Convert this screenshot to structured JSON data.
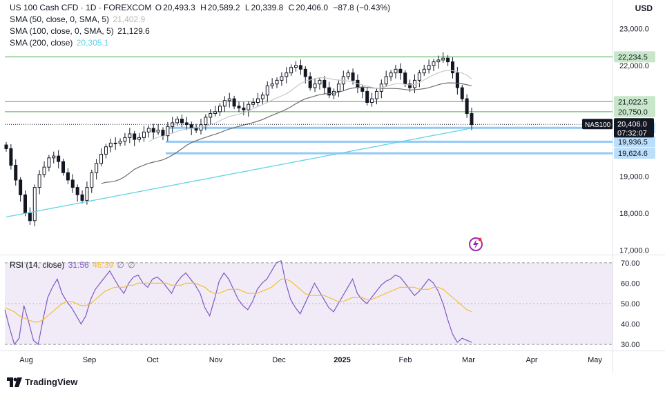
{
  "header": {
    "symbol_title": "US 100 Cash CFD · 1D · FOREXCOM",
    "ohlc": [
      {
        "label": "O",
        "value": "20,493.3"
      },
      {
        "label": "H",
        "value": "20,589.2"
      },
      {
        "label": "L",
        "value": "20,339.8"
      },
      {
        "label": "C",
        "value": "20,406.0"
      }
    ],
    "change": "−87.8 (−0.43%)",
    "currency": "USD"
  },
  "indicators": {
    "sma50": {
      "label": "SMA (50, close, 0, SMA, 5)",
      "value": "21,402.9",
      "color": "#b9b9b9"
    },
    "sma100": {
      "label": "SMA (100, close, 0, SMA, 5)",
      "value": "21,129.6",
      "color": "#555555"
    },
    "sma200": {
      "label": "SMA (200, close)",
      "value": "20,305.1",
      "color": "#62d3e6"
    }
  },
  "rsi_legend": {
    "label": "RSI (14, close)",
    "value": "31.56",
    "sma_value": "46.39",
    "zero1": "∅",
    "zero2": "∅"
  },
  "branding": {
    "name": "TradingView",
    "bolt_icon": "flash-icon"
  },
  "badges": {
    "symbol": "NAS100",
    "price": "20,406.0",
    "countdown": "07:32:07"
  },
  "chart_data": [
    {
      "type": "candlestick",
      "title": "US 100 Cash CFD · 1D · FOREXCOM",
      "y_axis": {
        "ticks": [
          17000,
          18000,
          19000,
          20000,
          21000,
          22000,
          23000
        ],
        "tick_labels": [
          "17,000.0",
          "18,000.0",
          "19,000.0",
          "20,000.0",
          "21,000.0",
          "22,000.0",
          "23,000.0"
        ],
        "range": [
          16900,
          23400
        ]
      },
      "x_axis": {
        "ticks": [
          "Aug",
          "Sep",
          "Oct",
          "Nov",
          "Dec",
          "2025",
          "Feb",
          "Mar",
          "Apr",
          "May"
        ]
      },
      "horizontal_levels": [
        {
          "value": 22234.5,
          "label": "22,234.5",
          "color": "#66bb6a"
        },
        {
          "value": 21022.5,
          "label": "21,022.5",
          "color": "#66bb6a"
        },
        {
          "value": 20750.0,
          "label": "20,750.0",
          "color": "#66bb6a"
        },
        {
          "value": 20314.5,
          "label": "20,314.5",
          "color": "#2196f3"
        },
        {
          "value": 19936.5,
          "label": "19,936.5",
          "color": "#2196f3"
        },
        {
          "value": 19624.6,
          "label": "19,624.6",
          "color": "#2196f3"
        }
      ],
      "series": [
        {
          "name": "US 100 Cash CFD",
          "kind": "ohlc",
          "close_path": [
            19750,
            19300,
            18900,
            18500,
            18000,
            17800,
            18700,
            19050,
            19250,
            19500,
            19550,
            19400,
            19100,
            18900,
            18700,
            18500,
            18350,
            18700,
            19100,
            19350,
            19600,
            19800,
            19900,
            19900,
            19950,
            20050,
            20150,
            20000,
            20050,
            20200,
            20300,
            20200,
            20250,
            20100,
            20350,
            20450,
            20550,
            20450,
            20400,
            20300,
            20250,
            20400,
            20600,
            20700,
            20750,
            20900,
            21050,
            21100,
            20900,
            20850,
            20800,
            20950,
            21000,
            21100,
            21200,
            21450,
            21500,
            21600,
            21700,
            21800,
            21950,
            22000,
            21900,
            21700,
            21400,
            21500,
            21600,
            21400,
            21200,
            21300,
            21500,
            21700,
            21800,
            21600,
            21400,
            21300,
            21000,
            21100,
            21300,
            21500,
            21700,
            21800,
            21900,
            21800,
            21500,
            21400,
            21600,
            21800,
            21900,
            22000,
            22100,
            22150,
            22200,
            22100,
            21800,
            21400,
            21100,
            20700,
            20400
          ]
        },
        {
          "name": "SMA (50, close, 0, SMA, 5)",
          "last": 21402.9
        },
        {
          "name": "SMA (100, close, 0, SMA, 5)",
          "last": 21129.6
        },
        {
          "name": "SMA (200, close)",
          "last": 20305.1
        }
      ]
    },
    {
      "type": "line",
      "title": "RSI (14, close)",
      "y_axis": {
        "ticks": [
          30,
          40,
          50,
          60,
          70
        ],
        "tick_labels": [
          "30.00",
          "40.00",
          "50.00",
          "60.00",
          "70.00"
        ],
        "range": [
          28,
          73
        ]
      },
      "band": [
        30,
        70
      ],
      "series": [
        {
          "name": "RSI",
          "color": "#7e57c2",
          "values": [
            47,
            38,
            30,
            33,
            49,
            41,
            32,
            30,
            42,
            53,
            58,
            62,
            55,
            51,
            48,
            44,
            40,
            44,
            52,
            57,
            60,
            63,
            66,
            62,
            58,
            55,
            60,
            63,
            64,
            60,
            58,
            62,
            63,
            61,
            58,
            55,
            60,
            63,
            65,
            62,
            59,
            55,
            48,
            44,
            52,
            61,
            65,
            62,
            57,
            52,
            49,
            47,
            51,
            57,
            60,
            62,
            66,
            70,
            71,
            60,
            52,
            48,
            45,
            50,
            55,
            60,
            56,
            52,
            48,
            46,
            50,
            54,
            58,
            62,
            55,
            52,
            50,
            53,
            56,
            59,
            61,
            62,
            64,
            63,
            60,
            57,
            54,
            56,
            59,
            62,
            60,
            56,
            50,
            42,
            35,
            31,
            33,
            32,
            31
          ]
        },
        {
          "name": "RSI-based SMA",
          "color": "#f5c032",
          "values": [
            48,
            47,
            46,
            44,
            43,
            42,
            41,
            41,
            42,
            44,
            46,
            48,
            50,
            51,
            51,
            50,
            49,
            49,
            50,
            52,
            54,
            56,
            57,
            58,
            58,
            58,
            59,
            59,
            60,
            60,
            60,
            60,
            60,
            60,
            60,
            59,
            59,
            59,
            60,
            60,
            60,
            59,
            58,
            56,
            55,
            55,
            56,
            57,
            57,
            57,
            56,
            55,
            55,
            55,
            56,
            57,
            58,
            60,
            62,
            62,
            61,
            59,
            57,
            55,
            54,
            54,
            54,
            54,
            53,
            52,
            51,
            51,
            52,
            53,
            53,
            53,
            52,
            52,
            53,
            54,
            55,
            56,
            57,
            58,
            58,
            58,
            58,
            57,
            57,
            57,
            58,
            58,
            57,
            55,
            53,
            51,
            49,
            47,
            46
          ]
        }
      ]
    }
  ]
}
